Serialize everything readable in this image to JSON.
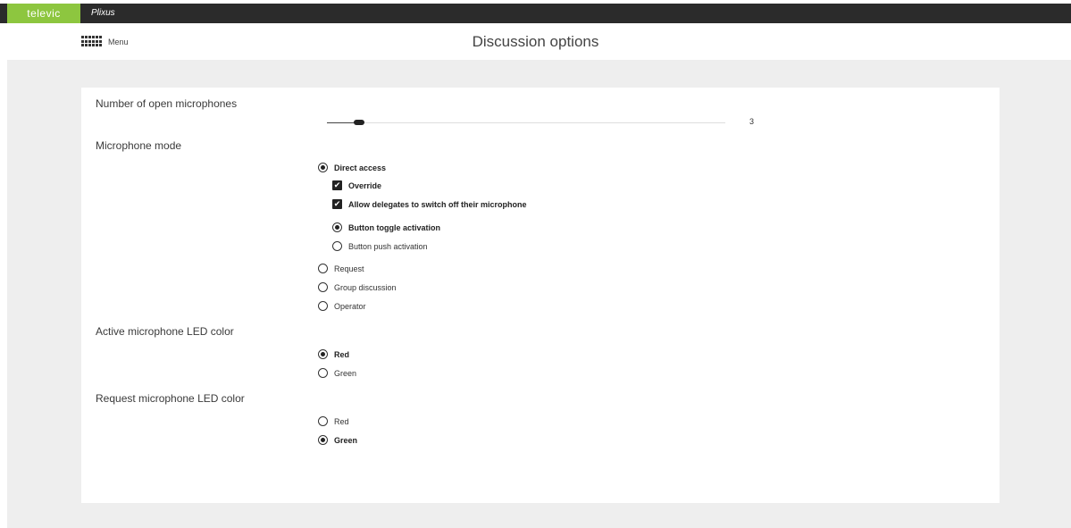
{
  "app": {
    "brand": "televic",
    "product": "Plixus"
  },
  "header": {
    "menu_label": "Menu",
    "title": "Discussion options"
  },
  "sections": {
    "open_mics": {
      "title": "Number of open microphones",
      "value": 3,
      "value_label": "3",
      "slider_fraction": 0.08
    },
    "mic_mode": {
      "title": "Microphone mode",
      "direct_access": "Direct access",
      "override": "Override",
      "allow_switch_off": "Allow delegates to switch off their microphone",
      "toggle_activation": "Button toggle activation",
      "push_activation": "Button push activation",
      "request": "Request",
      "group_discussion": "Group discussion",
      "operator": "Operator"
    },
    "active_led": {
      "title": "Active microphone LED color",
      "red": "Red",
      "green": "Green"
    },
    "request_led": {
      "title": "Request microphone LED color",
      "red": "Red",
      "green": "Green"
    }
  },
  "state": {
    "mic_mode": "direct_access",
    "override": true,
    "allow_switch_off": true,
    "activation": "toggle",
    "active_led": "red",
    "request_led": "green"
  }
}
